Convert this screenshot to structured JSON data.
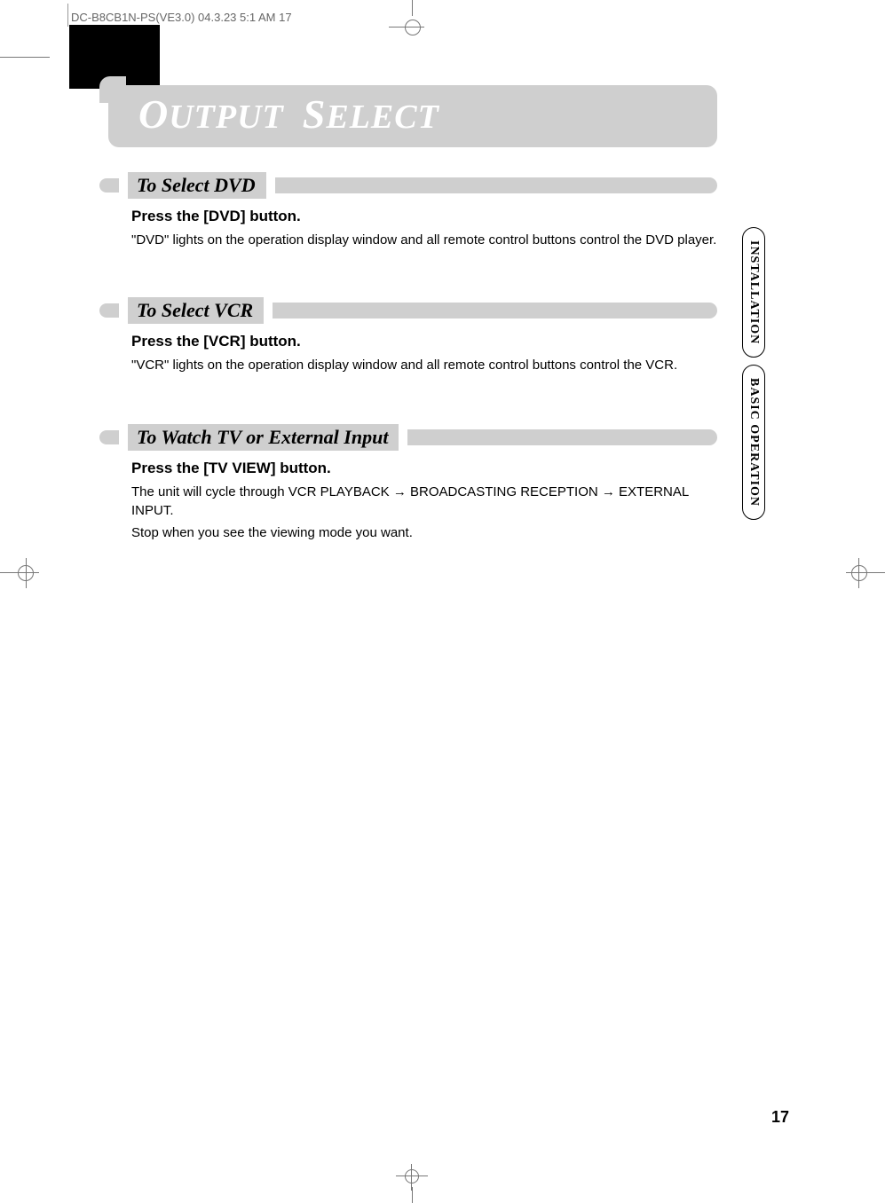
{
  "meta": {
    "header": "DC-B8CB1N-PS(VE3.0)  04.3.23 5:1 AM      17"
  },
  "title": {
    "word1_first": "O",
    "word1_rest": "UTPUT",
    "word2_first": "S",
    "word2_rest": "ELECT"
  },
  "sections": [
    {
      "heading": "To Select DVD",
      "instruction": "Press the [DVD] button.",
      "desc": "\"DVD\" lights on the operation display window and all remote control buttons control the DVD player."
    },
    {
      "heading": "To Select VCR",
      "instruction": "Press the [VCR] button.",
      "desc": "\"VCR\" lights on the operation display window and all remote control buttons control the VCR."
    },
    {
      "heading": "To Watch TV or External Input",
      "instruction": "Press the [TV VIEW] button.",
      "desc": "The unit will cycle through VCR PLAYBACK → BROADCASTING RECEPTION → EXTERNAL INPUT.",
      "desc2": "Stop when you see the viewing mode you want."
    }
  ],
  "tabs": {
    "tab1": "INSTALLATION",
    "tab2": "BASIC OPERATION"
  },
  "page_number": "17"
}
